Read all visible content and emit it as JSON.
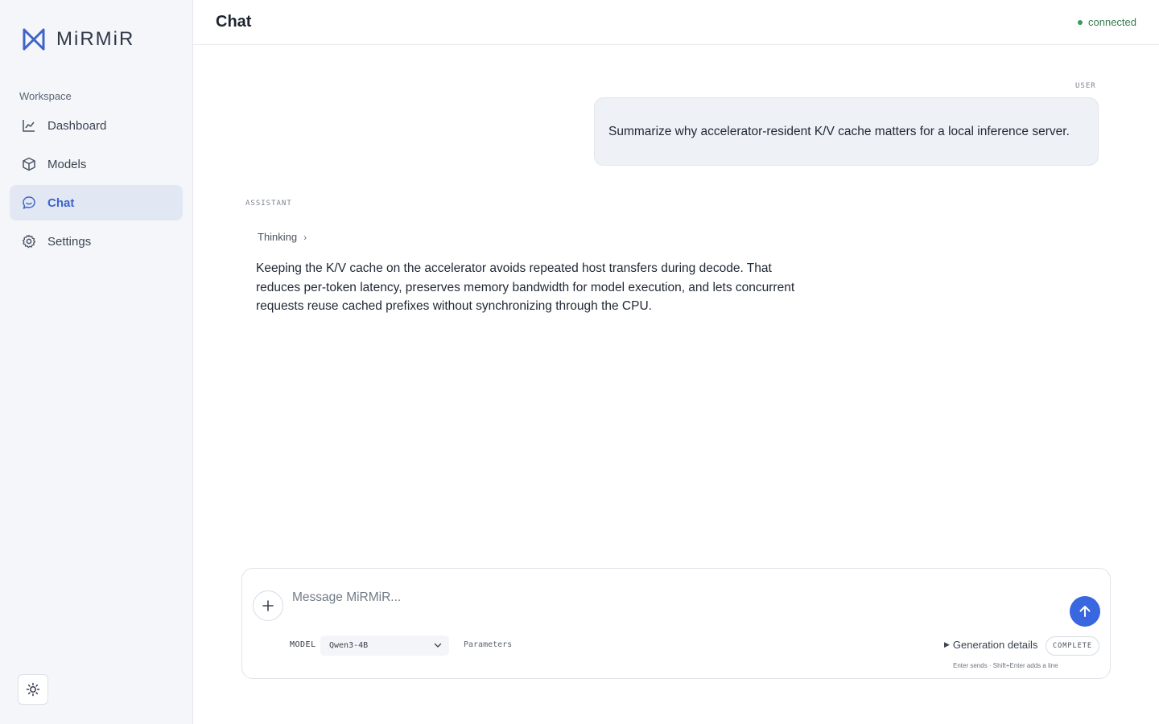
{
  "brand": {
    "name": "MiRMiR",
    "accent": "#3f64c8"
  },
  "sidebar": {
    "heading": "Workspace",
    "items": [
      {
        "label": "Dashboard",
        "icon": "chart-line-icon",
        "active": false
      },
      {
        "label": "Models",
        "icon": "cube-icon",
        "active": false
      },
      {
        "label": "Chat",
        "icon": "chat-bubble-icon",
        "active": true
      },
      {
        "label": "Settings",
        "icon": "gear-icon",
        "active": false
      }
    ],
    "theme_toggle_icon": "sun-icon"
  },
  "header": {
    "title": "Chat",
    "status": "connected",
    "status_color": "#3a9a57"
  },
  "conversation": {
    "user_role": "USER",
    "user_message": "Summarize why accelerator-resident K/V cache matters for a local inference server.",
    "assistant_role": "ASSISTANT",
    "thinking_label": "Thinking",
    "thinking_chevron": "›",
    "assistant_message": "Keeping the K/V cache on the accelerator avoids repeated host transfers during decode. That reduces per-token latency, preserves memory bandwidth for model execution, and lets concurrent requests reuse cached prefixes without synchronizing through the CPU."
  },
  "composer": {
    "placeholder": "Message MiRMiR...",
    "attach_icon": "plus-icon",
    "send_icon": "arrow-up-icon",
    "send_color": "#3867e0",
    "model_label": "MODEL",
    "model_value": "Qwen3-4B",
    "parameters_label": "Parameters",
    "generation_details_label": "Generation details",
    "generation_caret": "▶",
    "status_badge": "COMPLETE",
    "hint": "Enter sends · Shift+Enter adds a line"
  }
}
